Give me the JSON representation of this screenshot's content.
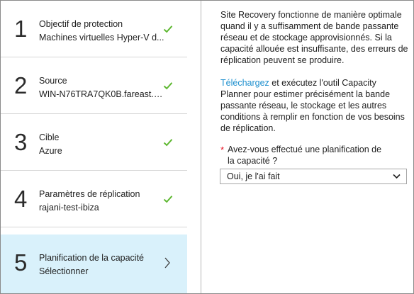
{
  "steps": [
    {
      "number": "1",
      "title": "Objectif de protection",
      "subtitle": "Machines virtuelles Hyper-V d...",
      "status": "complete"
    },
    {
      "number": "2",
      "title": "Source",
      "subtitle": "WIN-N76TRA7QK0B.fareast.cor...",
      "status": "complete"
    },
    {
      "number": "3",
      "title": "Cible",
      "subtitle": "Azure",
      "status": "complete"
    },
    {
      "number": "4",
      "title": "Paramètres de réplication",
      "subtitle": "rajani-test-ibiza",
      "status": "complete"
    },
    {
      "number": "5",
      "title": "Planification de la capacité",
      "subtitle": "Sélectionner",
      "status": "active"
    }
  ],
  "details": {
    "intro": "Site Recovery fonctionne de manière optimale quand il y a suffisamment de bande passante réseau et de stockage approvisionnés. Si la capacité allouée est insuffisante, des erreurs de réplication peuvent se produire.",
    "download_link": "Téléchargez",
    "download_text": " et exécutez l'outil Capacity Planner pour estimer précisément la bande passante réseau, le stockage et les autres conditions à remplir en fonction de vos besoins de réplication.",
    "required_marker": "*",
    "question": "Avez-vous effectué une planification de la capacité ?",
    "selected_option": "Oui, je l'ai fait"
  },
  "colors": {
    "check": "#5fb832",
    "active_step_bg": "#d9f1fb",
    "link": "#1d8fce",
    "required": "#e81123"
  },
  "icons": {
    "complete": "checkmark-icon",
    "active": "chevron-right-icon",
    "dropdown": "chevron-down-icon"
  }
}
